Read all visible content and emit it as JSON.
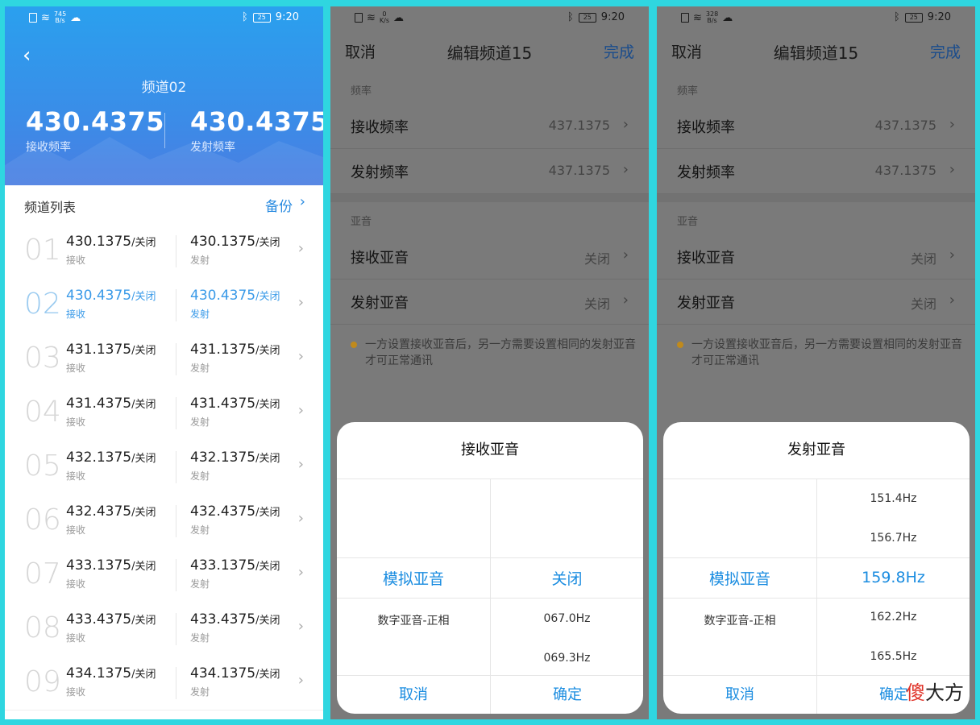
{
  "status_bars": [
    {
      "speed_top": "745",
      "speed_bottom": "B/s",
      "battery": "25",
      "time": "9:20"
    },
    {
      "speed_top": "0",
      "speed_bottom": "K/s",
      "battery": "25",
      "time": "9:20"
    },
    {
      "speed_top": "328",
      "speed_bottom": "B/s",
      "battery": "25",
      "time": "9:20"
    }
  ],
  "panel1": {
    "back_icon": "chevron-left-icon",
    "channel_title": "频道02",
    "rx_freq": "430.4375",
    "rx_label": "接收频率",
    "tx_freq": "430.4375",
    "tx_label": "发射频率",
    "list_title": "频道列表",
    "backup": "备份",
    "chevron": "›",
    "rows": [
      {
        "num": "01",
        "rx": "430.1375",
        "rx_suffix": "/关闭",
        "rx_label": "接收",
        "tx": "430.1375",
        "tx_suffix": "/关闭",
        "tx_label": "发射"
      },
      {
        "num": "02",
        "rx": "430.4375",
        "rx_suffix": "/关闭",
        "rx_label": "接收",
        "tx": "430.4375",
        "tx_suffix": "/关闭",
        "tx_label": "发射"
      },
      {
        "num": "03",
        "rx": "431.1375",
        "rx_suffix": "/关闭",
        "rx_label": "接收",
        "tx": "431.1375",
        "tx_suffix": "/关闭",
        "tx_label": "发射"
      },
      {
        "num": "04",
        "rx": "431.4375",
        "rx_suffix": "/关闭",
        "rx_label": "接收",
        "tx": "431.4375",
        "tx_suffix": "/关闭",
        "tx_label": "发射"
      },
      {
        "num": "05",
        "rx": "432.1375",
        "rx_suffix": "/关闭",
        "rx_label": "接收",
        "tx": "432.1375",
        "tx_suffix": "/关闭",
        "tx_label": "发射"
      },
      {
        "num": "06",
        "rx": "432.4375",
        "rx_suffix": "/关闭",
        "rx_label": "接收",
        "tx": "432.4375",
        "tx_suffix": "/关闭",
        "tx_label": "发射"
      },
      {
        "num": "07",
        "rx": "433.1375",
        "rx_suffix": "/关闭",
        "rx_label": "接收",
        "tx": "433.1375",
        "tx_suffix": "/关闭",
        "tx_label": "发射"
      },
      {
        "num": "08",
        "rx": "433.4375",
        "rx_suffix": "/关闭",
        "rx_label": "接收",
        "tx": "433.4375",
        "tx_suffix": "/关闭",
        "tx_label": "发射"
      },
      {
        "num": "09",
        "rx": "434.1375",
        "rx_suffix": "/关闭",
        "rx_label": "接收",
        "tx": "434.1375",
        "tx_suffix": "/关闭",
        "tx_label": "发射"
      }
    ]
  },
  "edit": {
    "cancel": "取消",
    "title": "编辑频道15",
    "done": "完成",
    "section_freq": "频率",
    "rx_freq_label": "接收频率",
    "rx_freq_value": "437.1375",
    "tx_freq_label": "发射频率",
    "tx_freq_value": "437.1375",
    "section_tone": "亚音",
    "rx_tone_label": "接收亚音",
    "rx_tone_value": "关闭",
    "tx_tone_label": "发射亚音",
    "tx_tone_value": "关闭",
    "note": "一方设置接收亚音后，另一方需要设置相同的发射亚音才可正常通讯",
    "chevron": "›"
  },
  "sheet_rx": {
    "title": "接收亚音",
    "left_options": [
      "模拟亚音",
      "数字亚音-正相"
    ],
    "right_options": [
      "关闭",
      "067.0Hz",
      "069.3Hz"
    ],
    "cancel": "取消",
    "confirm": "确定"
  },
  "sheet_tx": {
    "title": "发射亚音",
    "left_options": [
      "模拟亚音",
      "数字亚音-正相"
    ],
    "right_options": [
      "151.4Hz",
      "156.7Hz",
      "159.8Hz",
      "162.2Hz",
      "165.5Hz"
    ],
    "cancel": "取消",
    "confirm": "确定"
  },
  "watermark": {
    "red": "傻",
    "black": "大方"
  },
  "colors": {
    "accent": "#1a8ce0",
    "header_blue": "#2aa0ee",
    "background": "#2fd6e0"
  }
}
